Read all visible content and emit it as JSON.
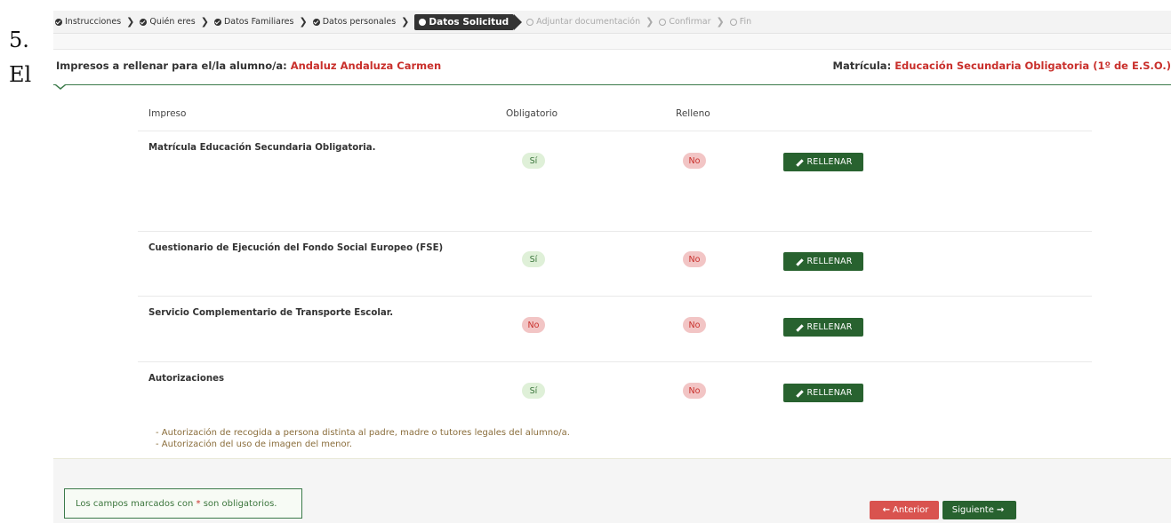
{
  "side": {
    "line1": "5.",
    "line2": "El"
  },
  "breadcrumb": {
    "steps": [
      {
        "label": "Instrucciones"
      },
      {
        "label": "Quién eres"
      },
      {
        "label": "Datos Familiares"
      },
      {
        "label": "Datos personales"
      }
    ],
    "active": "Datos Solicitud",
    "future": [
      {
        "label": "Adjuntar documentación"
      },
      {
        "label": "Confirmar"
      },
      {
        "label": "Fin"
      }
    ]
  },
  "header": {
    "left_label": "Impresos a rellenar para el/la alumno/a:",
    "student_name": "Andaluz Andaluza Carmen",
    "right_label": "Matrícula:",
    "enrollment": "Educación Secundaria Obligatoria (1º de E.S.O.)"
  },
  "table": {
    "columns": {
      "impreso": "Impreso",
      "obligatorio": "Obligatorio",
      "relleno": "Relleno"
    },
    "button_label": "RELLENAR",
    "rows": [
      {
        "title": "Matrícula Educación Secundaria Obligatoria.",
        "obligatorio": "Sí",
        "relleno": "No"
      },
      {
        "title": "Cuestionario de Ejecución del Fondo Social Europeo (FSE)",
        "obligatorio": "Sí",
        "relleno": "No"
      },
      {
        "title": "Servicio Complementario de Transporte Escolar.",
        "obligatorio": "No",
        "relleno": "No"
      },
      {
        "title": "Autorizaciones",
        "obligatorio": "Sí",
        "relleno": "No",
        "notes": [
          "- Autorización de recogida a persona distinta al padre, madre o tutores legales del alumno/a.",
          "- Autorización del uso de imagen del menor."
        ]
      }
    ]
  },
  "footer": {
    "note_prefix": "Los campos marcados con ",
    "note_asterisk": "*",
    "note_suffix": " son obligatorios.",
    "prev_label": "Anterior",
    "next_label": "Siguiente"
  },
  "colors": {
    "accent_green": "#28622f",
    "accent_red": "#c9302c",
    "badge_si": "#dff0d8",
    "badge_no": "#f2c5c5"
  },
  "icons": {
    "completed_step": "check-circle-icon",
    "pencil": "pencil-icon",
    "arrow_left": "arrow-left-icon",
    "arrow_right": "arrow-right-icon"
  }
}
